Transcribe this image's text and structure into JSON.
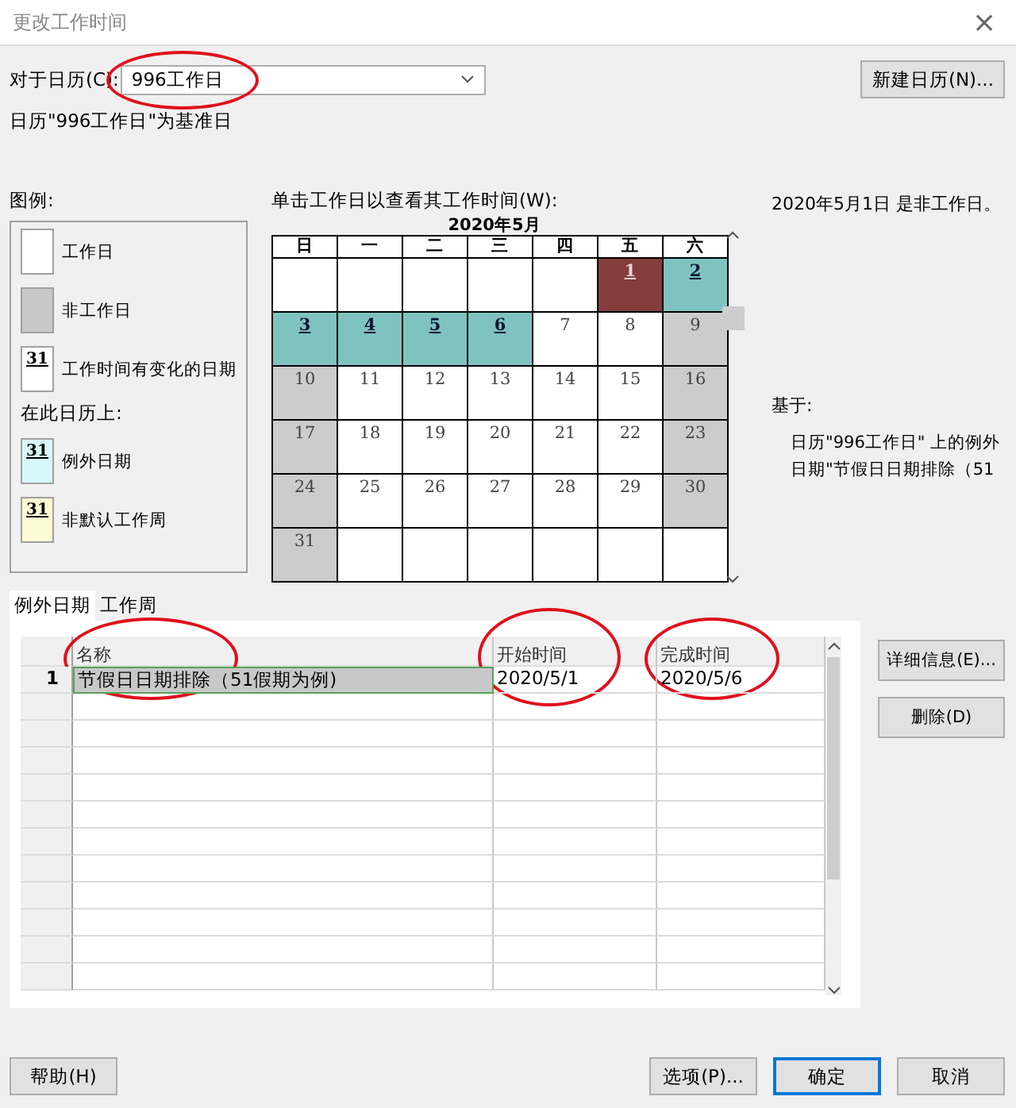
{
  "window": {
    "title": "更改工作时间",
    "close": "×"
  },
  "calendar_field": {
    "label": "对于日历(C):",
    "value": "996工作日",
    "circled": true
  },
  "new_calendar_button": "新建日历(N)...",
  "base_note": "日历\"996工作日\"为基准日",
  "legend": {
    "title": "图例:",
    "items": [
      {
        "kind": "work",
        "label": "工作日"
      },
      {
        "kind": "nonwork",
        "label": "非工作日"
      },
      {
        "kind": "changed",
        "label": "工作时间有变化的日期",
        "sample": "31"
      }
    ],
    "subtitle": "在此日历上:",
    "sub_items": [
      {
        "kind": "exception",
        "label": "例外日期",
        "sample": "31"
      },
      {
        "kind": "nondefault",
        "label": "非默认工作周",
        "sample": "31"
      }
    ]
  },
  "calendar": {
    "prompt": "单击工作日以查看其工作时间(W):",
    "month": "2020年5月",
    "weekdays": [
      "日",
      "一",
      "二",
      "三",
      "四",
      "五",
      "六"
    ],
    "days": [
      {
        "kind": "empty",
        "selected": false
      },
      {
        "kind": "empty",
        "selected": false
      },
      {
        "kind": "empty",
        "selected": false
      },
      {
        "kind": "empty",
        "selected": false
      },
      {
        "kind": "empty",
        "selected": false
      },
      {
        "label": "1",
        "kind": "exception",
        "selected": true
      },
      {
        "label": "2",
        "kind": "exception",
        "selected": false
      },
      {
        "label": "3",
        "kind": "exception",
        "selected": false
      },
      {
        "label": "4",
        "kind": "exception",
        "selected": false
      },
      {
        "label": "5",
        "kind": "exception",
        "selected": false
      },
      {
        "label": "6",
        "kind": "exception",
        "selected": false
      },
      {
        "label": "7",
        "kind": "work",
        "selected": false
      },
      {
        "label": "8",
        "kind": "work",
        "selected": false
      },
      {
        "label": "9",
        "kind": "nonwork",
        "selected": false
      },
      {
        "label": "10",
        "kind": "nonwork",
        "selected": false
      },
      {
        "label": "11",
        "kind": "work",
        "selected": false
      },
      {
        "label": "12",
        "kind": "work",
        "selected": false
      },
      {
        "label": "13",
        "kind": "work",
        "selected": false
      },
      {
        "label": "14",
        "kind": "work",
        "selected": false
      },
      {
        "label": "15",
        "kind": "work",
        "selected": false
      },
      {
        "label": "16",
        "kind": "nonwork",
        "selected": false
      },
      {
        "label": "17",
        "kind": "nonwork",
        "selected": false
      },
      {
        "label": "18",
        "kind": "work",
        "selected": false
      },
      {
        "label": "19",
        "kind": "work",
        "selected": false
      },
      {
        "label": "20",
        "kind": "work",
        "selected": false
      },
      {
        "label": "21",
        "kind": "work",
        "selected": false
      },
      {
        "label": "22",
        "kind": "work",
        "selected": false
      },
      {
        "label": "23",
        "kind": "nonwork",
        "selected": false
      },
      {
        "label": "24",
        "kind": "nonwork",
        "selected": false
      },
      {
        "label": "25",
        "kind": "work",
        "selected": false
      },
      {
        "label": "26",
        "kind": "work",
        "selected": false
      },
      {
        "label": "27",
        "kind": "work",
        "selected": false
      },
      {
        "label": "28",
        "kind": "work",
        "selected": false
      },
      {
        "label": "29",
        "kind": "work",
        "selected": false
      },
      {
        "label": "30",
        "kind": "nonwork",
        "selected": false
      },
      {
        "label": "31",
        "kind": "nonwork",
        "selected": false
      },
      {
        "kind": "empty",
        "selected": false
      },
      {
        "kind": "empty",
        "selected": false
      },
      {
        "kind": "empty",
        "selected": false
      },
      {
        "kind": "empty",
        "selected": false
      },
      {
        "kind": "empty",
        "selected": false
      },
      {
        "kind": "empty",
        "selected": false
      }
    ]
  },
  "info": {
    "status": "2020年5月1日 是非工作日。",
    "based_on_label": "基于:",
    "based_on_text": "日历\"996工作日\" 上的例外日期\"节假日日期排除（51"
  },
  "tabs": [
    {
      "label": "例外日期",
      "selected": true
    },
    {
      "label": "工作周",
      "selected": false
    }
  ],
  "table": {
    "columns": [
      {
        "label": "名称",
        "circled": true
      },
      {
        "label": "开始时间",
        "circled": true
      },
      {
        "label": "完成时间",
        "circled": true
      }
    ],
    "rows": [
      {
        "number": "1",
        "selected": true,
        "cells": [
          {
            "text": "节假日日期排除（51假期为例)"
          },
          {
            "text": "2020/5/1"
          },
          {
            "text": "2020/5/6"
          }
        ]
      }
    ]
  },
  "side_buttons": [
    "详细信息(E)...",
    "删除(D)"
  ],
  "footer": {
    "help": "帮助(H)",
    "buttons": [
      {
        "label": "选项(P)...",
        "default": false
      },
      {
        "label": "确定",
        "default": true
      },
      {
        "label": "取消",
        "default": false
      }
    ]
  }
}
